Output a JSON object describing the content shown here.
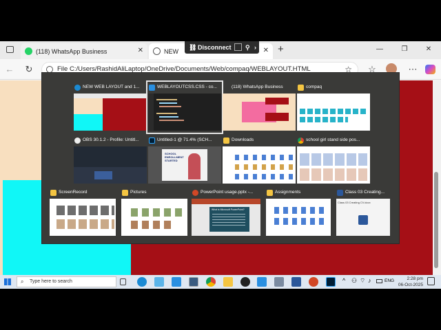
{
  "browser": {
    "tabs": [
      {
        "label": "(118) WhatsApp Business",
        "icon": "whatsapp-icon"
      },
      {
        "label": "NEW",
        "icon": "globe-icon"
      }
    ],
    "address": "File   C:/Users/RashidAliLaptop/OneDrive/Documents/Web/compaq/WEBLAYOUT.HTML",
    "remote_bar": {
      "label": "Disconnect"
    }
  },
  "switcher": {
    "windows": [
      {
        "title": "NEW WEB LAYOUT and 1...",
        "icon": "edge-icon"
      },
      {
        "title": "WEBLAYOUTCSS.CSS - co...",
        "icon": "vscode-icon"
      },
      {
        "title": "(118) WhatsApp Business",
        "icon": "blank-icon"
      },
      {
        "title": "compaq",
        "icon": "folder-icon"
      },
      {
        "title": "OBS 30.1.2 - Profile: Untitl...",
        "icon": "obs-icon"
      },
      {
        "title": "Untitled-1 @ 71.4% (SCH...",
        "icon": "photoshop-icon"
      },
      {
        "title": "Downloads",
        "icon": "folder-icon"
      },
      {
        "title": "school girl stand side pos...",
        "icon": "chrome-icon"
      },
      {
        "title": "ScreenRecord",
        "icon": "folder-icon"
      },
      {
        "title": "Pictures",
        "icon": "folder-icon"
      },
      {
        "title": "PowerPoint usage.pptx -...",
        "icon": "powerpoint-icon"
      },
      {
        "title": "Assignments",
        "icon": "folder-icon"
      },
      {
        "title": "Class 03 Creating...",
        "icon": "word-icon"
      }
    ],
    "thumb_texts": {
      "ps_line1": "SCHOOL",
      "ps_line2": "ENROLLMENT",
      "ps_line3": "STARTED",
      "ppt_heading": "What is Microsoft PowerPoint?",
      "word_doc": "Class 03 Creating CV.docx"
    }
  },
  "taskbar": {
    "search_placeholder": "Type here to search",
    "language": "ENG",
    "time": "2:28 pm",
    "date": "06-Oct-2025"
  },
  "colors": {
    "page_peach": "#f8dfbf",
    "page_red": "#a50f16",
    "page_cyan": "#10f7f7",
    "switcher_bg": "#3a3a38"
  }
}
